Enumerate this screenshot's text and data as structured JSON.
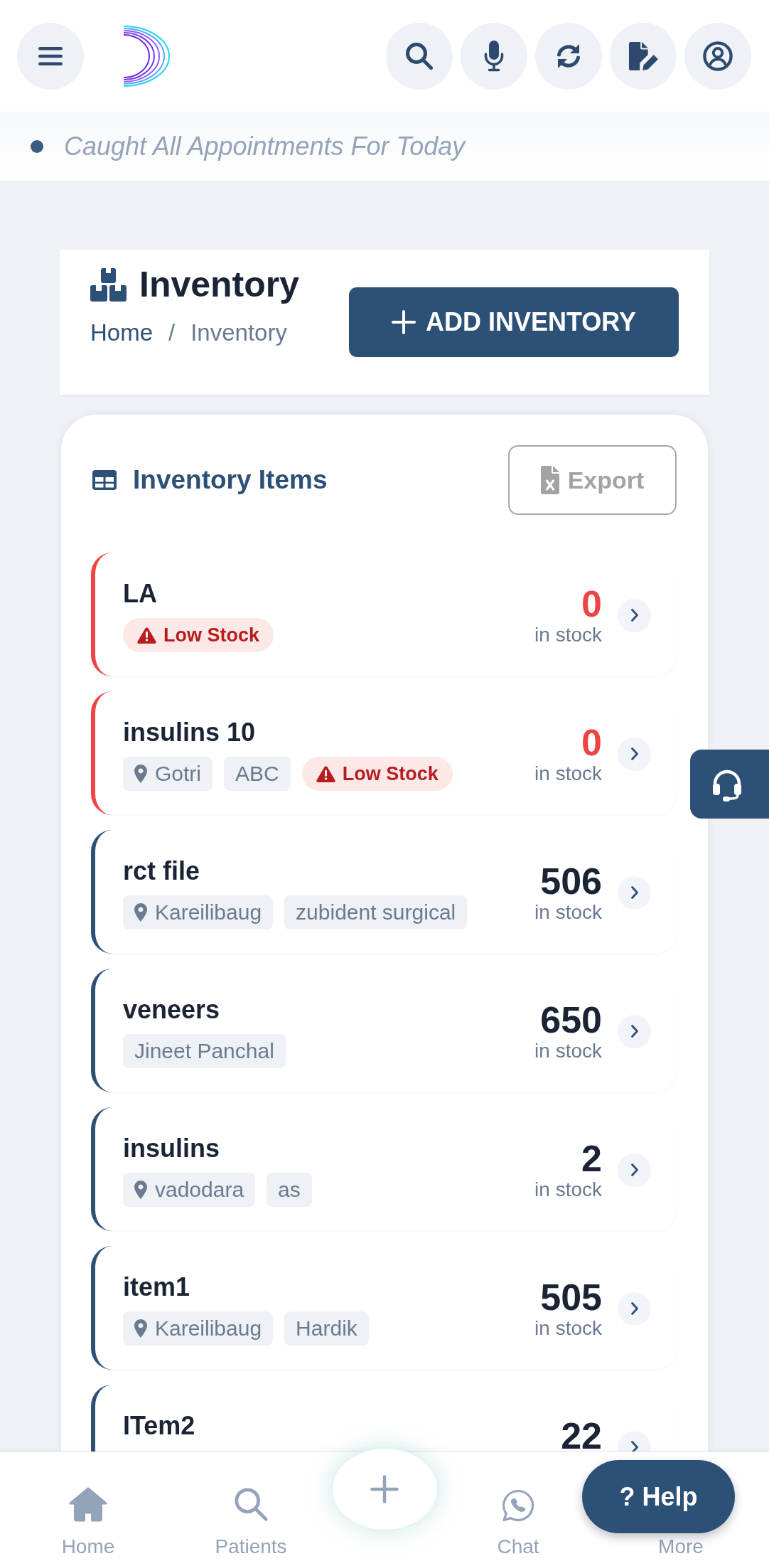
{
  "notice": {
    "text": "Caught All Appointments For Today"
  },
  "page_header": {
    "title": "Inventory",
    "breadcrumb": [
      {
        "label": "Home",
        "current": false
      },
      {
        "label": "Inventory",
        "current": true
      }
    ],
    "separator": "/",
    "add_button": "ADD INVENTORY"
  },
  "inventory_card": {
    "title": "Inventory Items",
    "export_button": "Export",
    "items": [
      {
        "name": "LA",
        "low_stock": true,
        "count": "0",
        "stock_label": "in stock",
        "tags": [
          {
            "kind": "alert",
            "text": "Low Stock"
          }
        ]
      },
      {
        "name": "insulins 10",
        "low_stock": true,
        "count": "0",
        "stock_label": "in stock",
        "tags": [
          {
            "kind": "location",
            "text": "Gotri"
          },
          {
            "kind": "plain",
            "text": "ABC"
          },
          {
            "kind": "alert",
            "text": "Low Stock"
          }
        ]
      },
      {
        "name": "rct file",
        "low_stock": false,
        "count": "506",
        "stock_label": "in stock",
        "tags": [
          {
            "kind": "location",
            "text": "Kareilibaug"
          },
          {
            "kind": "plain",
            "text": "zubident surgical"
          }
        ]
      },
      {
        "name": "veneers",
        "low_stock": false,
        "count": "650",
        "stock_label": "in stock",
        "tags": [
          {
            "kind": "plain",
            "text": "Jineet Panchal"
          }
        ]
      },
      {
        "name": "insulins",
        "low_stock": false,
        "count": "2",
        "stock_label": "in stock",
        "tags": [
          {
            "kind": "location",
            "text": "vadodara"
          },
          {
            "kind": "plain",
            "text": "as"
          }
        ]
      },
      {
        "name": "item1",
        "low_stock": false,
        "count": "505",
        "stock_label": "in stock",
        "tags": [
          {
            "kind": "location",
            "text": "Kareilibaug"
          },
          {
            "kind": "plain",
            "text": "Hardik"
          }
        ]
      },
      {
        "name": "ITem2",
        "low_stock": false,
        "count": "22"
      }
    ]
  },
  "bottom_nav": {
    "items": [
      {
        "kind": "home",
        "label": "Home"
      },
      {
        "kind": "search",
        "label": "Patients"
      },
      {
        "kind": "add"
      },
      {
        "kind": "chat",
        "label": "Chat"
      },
      {
        "kind": "more",
        "label": "More"
      }
    ]
  },
  "help_button": {
    "label": "? Help"
  }
}
